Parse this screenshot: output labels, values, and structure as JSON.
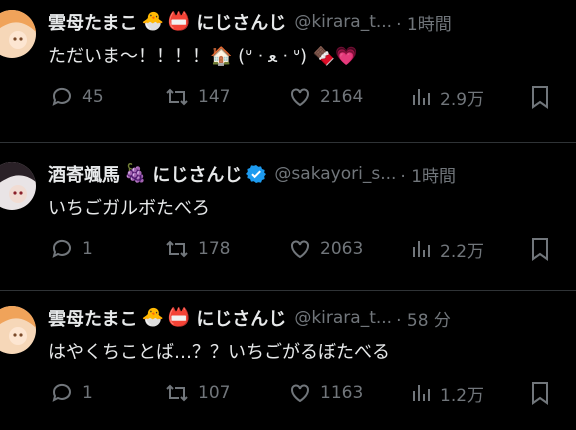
{
  "colors": {
    "background": "#000000",
    "text": "#e7e9ea",
    "muted": "#71767b",
    "verified": "#1d9bf0"
  },
  "tweets": [
    {
      "name": "雲母たまこ",
      "badges": [
        "🐣",
        "📛"
      ],
      "affiliation": "にじさんじ",
      "handle": "@kirara_t...",
      "time": "· 1時間",
      "text": "ただいま〜！！！！🏠 (ᐡ ᐧ ﻌ ᐧ ᐡ) 🍫💗",
      "replies": "45",
      "retweets": "147",
      "likes": "2164",
      "views": "2.9万"
    },
    {
      "name": "酒寄颯馬",
      "badges": [
        "🍇"
      ],
      "affiliation": "にじさんじ",
      "verified": true,
      "handle": "@sakayori_s...",
      "time": "· 1時間",
      "text": "いちごガルボたべろ",
      "replies": "1",
      "retweets": "178",
      "likes": "2063",
      "views": "2.2万"
    },
    {
      "name": "雲母たまこ",
      "badges": [
        "🐣",
        "📛"
      ],
      "affiliation": "にじさんじ",
      "handle": "@kirara_t...",
      "time": "· 58 分",
      "text": "はやくちことば…？？いちごがるぼたべる",
      "replies": "1",
      "retweets": "107",
      "likes": "1163",
      "views": "1.2万"
    }
  ]
}
